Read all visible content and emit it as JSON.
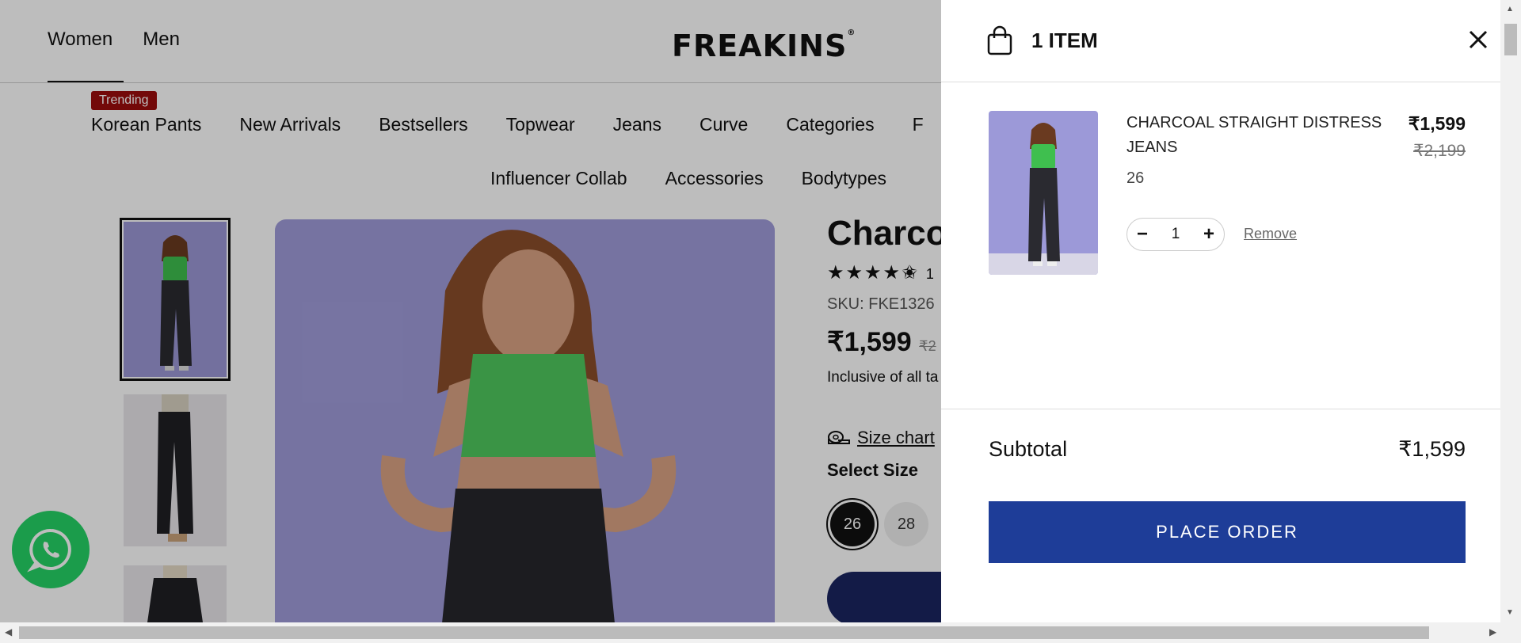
{
  "site": {
    "logo": "FREAKINS",
    "logo_mark": "®",
    "top_nav": [
      "Women",
      "Men"
    ],
    "trending_badge": "Trending",
    "categories_row1": [
      "Korean Pants",
      "New Arrivals",
      "Bestsellers",
      "Topwear",
      "Jeans",
      "Curve",
      "Categories",
      "F"
    ],
    "categories_row2": [
      "Influencer Collab",
      "Accessories",
      "Bodytypes"
    ]
  },
  "product": {
    "title": "Charcoa",
    "stars": "★★★★✬",
    "rating_count": "1",
    "sku": "SKU: FKE1326",
    "price": "₹1,599",
    "orig_price": "₹2",
    "tax_note": "Inclusive of all ta",
    "size_chart": "Size chart",
    "select_size": "Select Size",
    "sizes": [
      "26",
      "28"
    ],
    "selected_size": "26"
  },
  "cart": {
    "title": "1 ITEM",
    "item": {
      "name": "CHARCOAL STRAIGHT DISTRESS JEANS",
      "size": "26",
      "price": "₹1,599",
      "orig_price": "₹2,199",
      "qty": "1",
      "minus": "−",
      "plus": "+",
      "remove": "Remove"
    },
    "subtotal_label": "Subtotal",
    "subtotal_value": "₹1,599",
    "place_order": "PLACE ORDER"
  },
  "colors": {
    "accent": "#1e3d98",
    "badge": "#9b0d0d",
    "whatsapp": "#25d366",
    "add_button": "#1a2560"
  }
}
